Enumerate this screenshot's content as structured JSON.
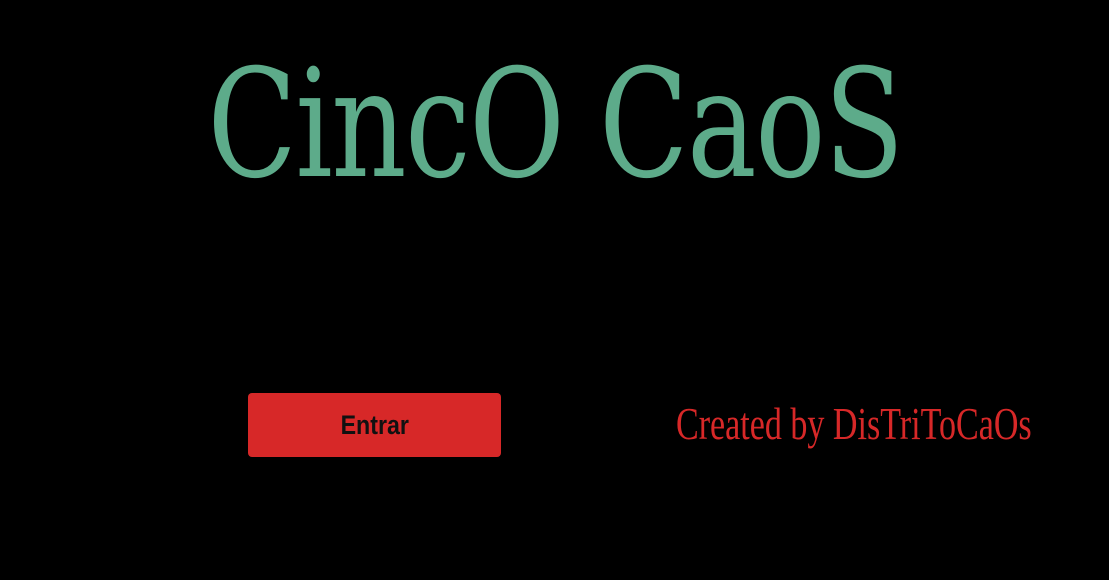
{
  "game": {
    "title": "CincO CaoS",
    "enter_button_label": "Entrar",
    "credits_text": "Created by DisTriToCaOs"
  },
  "colors": {
    "background": "#000000",
    "title": "#5dab8a",
    "button_bg": "#d72828",
    "credits": "#d72828"
  }
}
